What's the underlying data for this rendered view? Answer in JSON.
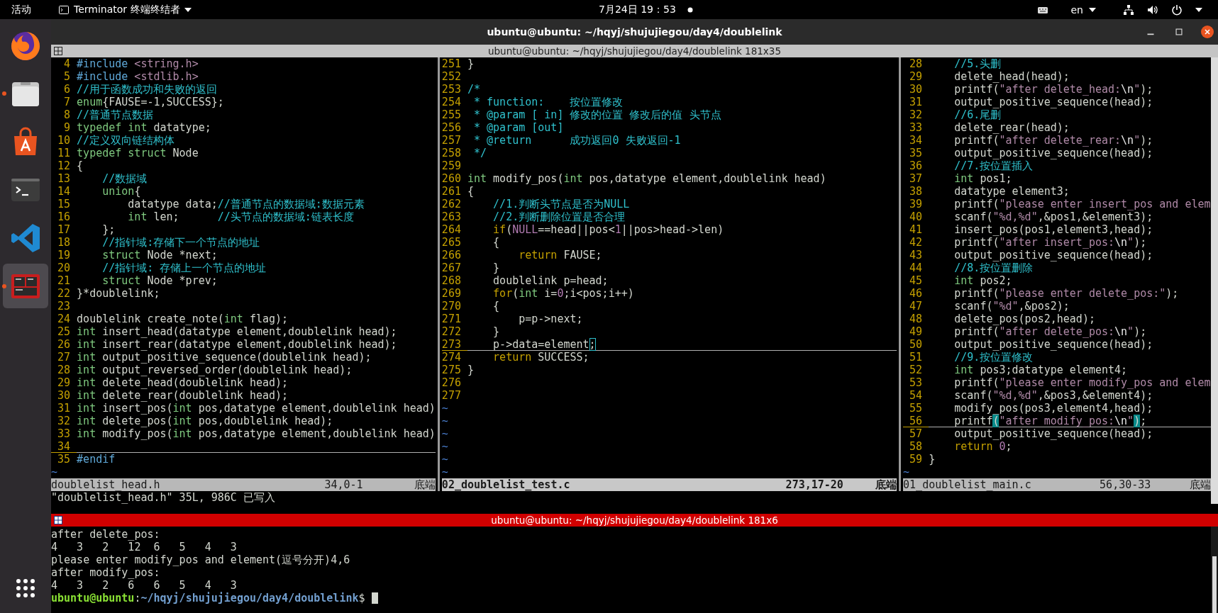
{
  "top_bar": {
    "activities": "活动",
    "app_menu": "Terminator 终端终结者",
    "clock": "7月24日  19：53",
    "language": "en"
  },
  "dock": {
    "apps": [
      {
        "running": false,
        "active": false
      },
      {
        "running": true,
        "active": false
      },
      {
        "running": false,
        "active": false
      },
      {
        "running": false,
        "active": false
      },
      {
        "running": false,
        "active": false
      },
      {
        "running": true,
        "active": true
      }
    ]
  },
  "window": {
    "title": "ubuntu@ubuntu: ~/hqyj/shujujiegou/day4/doublelink"
  },
  "upper_terminal": {
    "title": "ubuntu@ubuntu: ~/hqyj/shujujiegou/day4/doublelink 181x35",
    "panes": [
      {
        "lines": [
          {
            "number": "4",
            "current": false,
            "segments": [
              {
                "text": "#include",
                "kind": "preproc"
              },
              {
                "text": " <string.h>",
                "kind": "string"
              }
            ]
          },
          {
            "number": "5",
            "current": false,
            "segments": [
              {
                "text": "#include",
                "kind": "preproc"
              },
              {
                "text": " <stdlib.h>",
                "kind": "string"
              }
            ]
          },
          {
            "number": "6",
            "current": false,
            "segments": [
              {
                "text": "//用于函数成功和失败的返回",
                "kind": "comment"
              }
            ]
          },
          {
            "number": "7",
            "current": false,
            "segments": [
              {
                "text": "enum",
                "kind": "type"
              },
              {
                "text": "{FAUSE=-1,SUCCESS};",
                "kind": "plain"
              }
            ]
          },
          {
            "number": "8",
            "current": false,
            "segments": [
              {
                "text": "//普通节点数据",
                "kind": "comment"
              }
            ]
          },
          {
            "number": "9",
            "current": false,
            "segments": [
              {
                "text": "typedef int",
                "kind": "type"
              },
              {
                "text": " datatype;",
                "kind": "plain"
              }
            ]
          },
          {
            "number": "10",
            "current": false,
            "segments": [
              {
                "text": "//定义双向链结构体",
                "kind": "comment"
              }
            ]
          },
          {
            "number": "11",
            "current": false,
            "segments": [
              {
                "text": "typedef struct",
                "kind": "type"
              },
              {
                "text": " Node",
                "kind": "plain"
              }
            ]
          },
          {
            "number": "12",
            "current": false,
            "segments": [
              {
                "text": "{",
                "kind": "plain"
              }
            ]
          },
          {
            "number": "13",
            "current": false,
            "segments": [
              {
                "text": "    //数据域",
                "kind": "comment"
              }
            ]
          },
          {
            "number": "14",
            "current": false,
            "segments": [
              {
                "text": "    union",
                "kind": "type"
              },
              {
                "text": "{",
                "kind": "plain"
              }
            ]
          },
          {
            "number": "15",
            "current": false,
            "segments": [
              {
                "text": "        datatype data;",
                "kind": "plain"
              },
              {
                "text": "//普通节点的数据域:数据元素",
                "kind": "comment"
              }
            ]
          },
          {
            "number": "16",
            "current": false,
            "segments": [
              {
                "text": "        int",
                "kind": "type"
              },
              {
                "text": " len;      ",
                "kind": "plain"
              },
              {
                "text": "//头节点的数据域:链表长度",
                "kind": "comment"
              }
            ]
          },
          {
            "number": "17",
            "current": false,
            "segments": [
              {
                "text": "    };",
                "kind": "plain"
              }
            ]
          },
          {
            "number": "18",
            "current": false,
            "segments": [
              {
                "text": "    //指针域:存储下一个节点的地址",
                "kind": "comment"
              }
            ]
          },
          {
            "number": "19",
            "current": false,
            "segments": [
              {
                "text": "    struct",
                "kind": "type"
              },
              {
                "text": " Node *next;",
                "kind": "plain"
              }
            ]
          },
          {
            "number": "20",
            "current": false,
            "segments": [
              {
                "text": "    //指针域: 存储上一个节点的地址",
                "kind": "comment"
              }
            ]
          },
          {
            "number": "21",
            "current": false,
            "segments": [
              {
                "text": "    struct",
                "kind": "type"
              },
              {
                "text": " Node *prev;",
                "kind": "plain"
              }
            ]
          },
          {
            "number": "22",
            "current": false,
            "segments": [
              {
                "text": "}*doublelink;",
                "kind": "plain"
              }
            ]
          },
          {
            "number": "23",
            "current": false
          },
          {
            "number": "24",
            "current": false,
            "segments": [
              {
                "text": "doublelink create_note(",
                "kind": "plain"
              },
              {
                "text": "int",
                "kind": "type"
              },
              {
                "text": " flag);",
                "kind": "plain"
              }
            ]
          },
          {
            "number": "25",
            "current": false,
            "segments": [
              {
                "text": "int",
                "kind": "type"
              },
              {
                "text": " insert_head(datatype element,doublelink head);",
                "kind": "plain"
              }
            ]
          },
          {
            "number": "26",
            "current": false,
            "segments": [
              {
                "text": "int",
                "kind": "type"
              },
              {
                "text": " insert_rear(datatype element,doublelink head);",
                "kind": "plain"
              }
            ]
          },
          {
            "number": "27",
            "current": false,
            "segments": [
              {
                "text": "int",
                "kind": "type"
              },
              {
                "text": " output_positive_sequence(doublelink head);",
                "kind": "plain"
              }
            ]
          },
          {
            "number": "28",
            "current": false,
            "segments": [
              {
                "text": "int",
                "kind": "type"
              },
              {
                "text": " output_reversed_order(doublelink head);",
                "kind": "plain"
              }
            ]
          },
          {
            "number": "29",
            "current": false,
            "segments": [
              {
                "text": "int",
                "kind": "type"
              },
              {
                "text": " delete_head(doublelink head);",
                "kind": "plain"
              }
            ]
          },
          {
            "number": "30",
            "current": false,
            "segments": [
              {
                "text": "int",
                "kind": "type"
              },
              {
                "text": " delete_rear(doublelink head);",
                "kind": "plain"
              }
            ]
          },
          {
            "number": "31",
            "current": false,
            "segments": [
              {
                "text": "int",
                "kind": "type"
              },
              {
                "text": " insert_pos(",
                "kind": "plain"
              },
              {
                "text": "int",
                "kind": "type"
              },
              {
                "text": " pos,datatype element,doublelink head)",
                "kind": "plain"
              }
            ]
          },
          {
            "number": "32",
            "current": false,
            "segments": [
              {
                "text": "int",
                "kind": "type"
              },
              {
                "text": " delete_pos(",
                "kind": "plain"
              },
              {
                "text": "int",
                "kind": "type"
              },
              {
                "text": " pos,doublelink head);",
                "kind": "plain"
              }
            ]
          },
          {
            "number": "33",
            "current": false,
            "segments": [
              {
                "text": "int",
                "kind": "type"
              },
              {
                "text": " modify_pos(",
                "kind": "plain"
              },
              {
                "text": "int",
                "kind": "type"
              },
              {
                "text": " pos,datatype element,doublelink head)",
                "kind": "plain"
              }
            ]
          },
          {
            "number": "34",
            "current": true
          },
          {
            "number": "35",
            "current": false,
            "segments": [
              {
                "text": "#endif",
                "kind": "preproc"
              }
            ]
          }
        ],
        "filler": [
          "~"
        ],
        "status": {
          "file": "doublelist_head.h",
          "position": "34,0-1",
          "scroll": "底端",
          "active": false
        }
      },
      {
        "lines": [
          {
            "number": "251",
            "current": false,
            "segments": [
              {
                "text": "}",
                "kind": "plain"
              }
            ]
          },
          {
            "number": "252",
            "current": false
          },
          {
            "number": "253",
            "current": false,
            "segments": [
              {
                "text": "/*",
                "kind": "comment"
              }
            ]
          },
          {
            "number": "254",
            "current": false,
            "segments": [
              {
                "text": " * function:    按位置修改",
                "kind": "comment"
              }
            ]
          },
          {
            "number": "255",
            "current": false,
            "segments": [
              {
                "text": " * @param [ in] 修改的位置 修改后的值 头节点",
                "kind": "comment"
              }
            ]
          },
          {
            "number": "256",
            "current": false,
            "segments": [
              {
                "text": " * @param [out]",
                "kind": "comment"
              }
            ]
          },
          {
            "number": "257",
            "current": false,
            "segments": [
              {
                "text": " * @return      成功返回0 失败返回-1",
                "kind": "comment"
              }
            ]
          },
          {
            "number": "258",
            "current": false,
            "segments": [
              {
                "text": " */",
                "kind": "comment"
              }
            ]
          },
          {
            "number": "259",
            "current": false
          },
          {
            "number": "260",
            "current": false,
            "segments": [
              {
                "text": "int",
                "kind": "type"
              },
              {
                "text": " modify_pos(",
                "kind": "plain"
              },
              {
                "text": "int",
                "kind": "type"
              },
              {
                "text": " pos,datatype element,doublelink head)",
                "kind": "plain"
              }
            ]
          },
          {
            "number": "261",
            "current": false,
            "segments": [
              {
                "text": "{",
                "kind": "plain"
              }
            ]
          },
          {
            "number": "262",
            "current": false,
            "segments": [
              {
                "text": "    //1.判断头节点是否为NULL",
                "kind": "comment"
              }
            ]
          },
          {
            "number": "263",
            "current": false,
            "segments": [
              {
                "text": "    //2.判断删除位置是否合理",
                "kind": "comment"
              }
            ]
          },
          {
            "number": "264",
            "current": false,
            "segments": [
              {
                "text": "    if",
                "kind": "keyword"
              },
              {
                "text": "(",
                "kind": "plain"
              },
              {
                "text": "NULL",
                "kind": "constant"
              },
              {
                "text": "==head||pos<",
                "kind": "plain"
              },
              {
                "text": "1",
                "kind": "constant"
              },
              {
                "text": "||pos>head->len)",
                "kind": "plain"
              }
            ]
          },
          {
            "number": "265",
            "current": false,
            "segments": [
              {
                "text": "    {",
                "kind": "plain"
              }
            ]
          },
          {
            "number": "266",
            "current": false,
            "segments": [
              {
                "text": "        return",
                "kind": "keyword"
              },
              {
                "text": " FAUSE;",
                "kind": "plain"
              }
            ]
          },
          {
            "number": "267",
            "current": false,
            "segments": [
              {
                "text": "    }",
                "kind": "plain"
              }
            ]
          },
          {
            "number": "268",
            "current": false,
            "segments": [
              {
                "text": "    doublelink p=head;",
                "kind": "plain"
              }
            ]
          },
          {
            "number": "269",
            "current": false,
            "segments": [
              {
                "text": "    for",
                "kind": "keyword"
              },
              {
                "text": "(",
                "kind": "plain"
              },
              {
                "text": "int",
                "kind": "type"
              },
              {
                "text": " i=",
                "kind": "plain"
              },
              {
                "text": "0",
                "kind": "constant"
              },
              {
                "text": ";i<pos;i++)",
                "kind": "plain"
              }
            ]
          },
          {
            "number": "270",
            "current": false,
            "segments": [
              {
                "text": "    {",
                "kind": "plain"
              }
            ]
          },
          {
            "number": "271",
            "current": false,
            "segments": [
              {
                "text": "        p=p->next;",
                "kind": "plain"
              }
            ]
          },
          {
            "number": "272",
            "current": false,
            "segments": [
              {
                "text": "    }",
                "kind": "plain"
              }
            ]
          },
          {
            "number": "273",
            "current": true,
            "segments": [
              {
                "text": "    p->data=element",
                "kind": "plain"
              },
              {
                "text": ";",
                "kind": "cursor"
              }
            ]
          },
          {
            "number": "274",
            "current": false,
            "segments": [
              {
                "text": "    return",
                "kind": "keyword"
              },
              {
                "text": " SUCCESS;",
                "kind": "plain"
              }
            ]
          },
          {
            "number": "275",
            "current": false,
            "segments": [
              {
                "text": "}",
                "kind": "plain"
              }
            ]
          },
          {
            "number": "276",
            "current": false
          },
          {
            "number": "277",
            "current": false
          }
        ],
        "filler": [
          "~",
          "~",
          "~",
          "~",
          "~",
          "~"
        ],
        "status": {
          "file": "02_doublelist_test.c",
          "position": "273,17-20",
          "scroll": "底端",
          "active": true
        }
      },
      {
        "lines": [
          {
            "number": "28",
            "current": false,
            "segments": [
              {
                "text": "    //5.头删",
                "kind": "comment"
              }
            ]
          },
          {
            "number": "29",
            "current": false,
            "segments": [
              {
                "text": "    delete_head(head);",
                "kind": "plain"
              }
            ]
          },
          {
            "number": "30",
            "current": false,
            "segments": [
              {
                "text": "    printf(",
                "kind": "plain"
              },
              {
                "text": "\"after delete_head:",
                "kind": "string"
              },
              {
                "text": "\\n",
                "kind": "special"
              },
              {
                "text": "\"",
                "kind": "string"
              },
              {
                "text": ");",
                "kind": "plain"
              }
            ]
          },
          {
            "number": "31",
            "current": false,
            "segments": [
              {
                "text": "    output_positive_sequence(head);",
                "kind": "plain"
              }
            ]
          },
          {
            "number": "32",
            "current": false,
            "segments": [
              {
                "text": "    //6.尾删",
                "kind": "comment"
              }
            ]
          },
          {
            "number": "33",
            "current": false,
            "segments": [
              {
                "text": "    delete_rear(head);",
                "kind": "plain"
              }
            ]
          },
          {
            "number": "34",
            "current": false,
            "segments": [
              {
                "text": "    printf(",
                "kind": "plain"
              },
              {
                "text": "\"after delete_rear:",
                "kind": "string"
              },
              {
                "text": "\\n",
                "kind": "special"
              },
              {
                "text": "\"",
                "kind": "string"
              },
              {
                "text": ");",
                "kind": "plain"
              }
            ]
          },
          {
            "number": "35",
            "current": false,
            "segments": [
              {
                "text": "    output_positive_sequence(head);",
                "kind": "plain"
              }
            ]
          },
          {
            "number": "36",
            "current": false,
            "segments": [
              {
                "text": "    //7.按位置插入",
                "kind": "comment"
              }
            ]
          },
          {
            "number": "37",
            "current": false,
            "segments": [
              {
                "text": "    int",
                "kind": "type"
              },
              {
                "text": " pos1;",
                "kind": "plain"
              }
            ]
          },
          {
            "number": "38",
            "current": false,
            "segments": [
              {
                "text": "    datatype element3;",
                "kind": "plain"
              }
            ]
          },
          {
            "number": "39",
            "current": false,
            "segments": [
              {
                "text": "    printf(",
                "kind": "plain"
              },
              {
                "text": "\"please enter insert_pos and elem",
                "kind": "string"
              }
            ]
          },
          {
            "number": "40",
            "current": false,
            "segments": [
              {
                "text": "    scanf(",
                "kind": "plain"
              },
              {
                "text": "\"%d,%d\"",
                "kind": "string"
              },
              {
                "text": ",&pos1,&element3);",
                "kind": "plain"
              }
            ]
          },
          {
            "number": "41",
            "current": false,
            "segments": [
              {
                "text": "    insert_pos(pos1,element3,head);",
                "kind": "plain"
              }
            ]
          },
          {
            "number": "42",
            "current": false,
            "segments": [
              {
                "text": "    printf(",
                "kind": "plain"
              },
              {
                "text": "\"after insert_pos:",
                "kind": "string"
              },
              {
                "text": "\\n",
                "kind": "special"
              },
              {
                "text": "\"",
                "kind": "string"
              },
              {
                "text": ");",
                "kind": "plain"
              }
            ]
          },
          {
            "number": "43",
            "current": false,
            "segments": [
              {
                "text": "    output_positive_sequence(head);",
                "kind": "plain"
              }
            ]
          },
          {
            "number": "44",
            "current": false,
            "segments": [
              {
                "text": "    //8.按位置删除",
                "kind": "comment"
              }
            ]
          },
          {
            "number": "45",
            "current": false,
            "segments": [
              {
                "text": "    int",
                "kind": "type"
              },
              {
                "text": " pos2;",
                "kind": "plain"
              }
            ]
          },
          {
            "number": "46",
            "current": false,
            "segments": [
              {
                "text": "    printf(",
                "kind": "plain"
              },
              {
                "text": "\"please enter delete_pos:\"",
                "kind": "string"
              },
              {
                "text": ");",
                "kind": "plain"
              }
            ]
          },
          {
            "number": "47",
            "current": false,
            "segments": [
              {
                "text": "    scanf(",
                "kind": "plain"
              },
              {
                "text": "\"%d\"",
                "kind": "string"
              },
              {
                "text": ",&pos2);",
                "kind": "plain"
              }
            ]
          },
          {
            "number": "48",
            "current": false,
            "segments": [
              {
                "text": "    delete_pos(pos2,head);",
                "kind": "plain"
              }
            ]
          },
          {
            "number": "49",
            "current": false,
            "segments": [
              {
                "text": "    printf(",
                "kind": "plain"
              },
              {
                "text": "\"after delete_pos:",
                "kind": "string"
              },
              {
                "text": "\\n",
                "kind": "special"
              },
              {
                "text": "\"",
                "kind": "string"
              },
              {
                "text": ");",
                "kind": "plain"
              }
            ]
          },
          {
            "number": "50",
            "current": false,
            "segments": [
              {
                "text": "    output_positive_sequence(head);",
                "kind": "plain"
              }
            ]
          },
          {
            "number": "51",
            "current": false,
            "segments": [
              {
                "text": "    //9.按位置修改",
                "kind": "comment"
              }
            ]
          },
          {
            "number": "52",
            "current": false,
            "segments": [
              {
                "text": "    int",
                "kind": "type"
              },
              {
                "text": " pos3;datatype element4;",
                "kind": "plain"
              }
            ]
          },
          {
            "number": "53",
            "current": false,
            "segments": [
              {
                "text": "    printf(",
                "kind": "plain"
              },
              {
                "text": "\"please enter modify_pos and elem",
                "kind": "string"
              }
            ]
          },
          {
            "number": "54",
            "current": false,
            "segments": [
              {
                "text": "    scanf(",
                "kind": "plain"
              },
              {
                "text": "\"%d,%d\"",
                "kind": "string"
              },
              {
                "text": ",&pos3,&element4);",
                "kind": "plain"
              }
            ]
          },
          {
            "number": "55",
            "current": false,
            "segments": [
              {
                "text": "    modify_pos(pos3,element4,head);",
                "kind": "plain"
              }
            ]
          },
          {
            "number": "56",
            "current": true,
            "segments": [
              {
                "text": "    printf",
                "kind": "plain"
              },
              {
                "text": "(",
                "kind": "match"
              },
              {
                "text": "\"after modify_pos:",
                "kind": "string"
              },
              {
                "text": "\\n",
                "kind": "special"
              },
              {
                "text": "\"",
                "kind": "string"
              },
              {
                "text": ")",
                "kind": "match"
              },
              {
                "text": ";",
                "kind": "plain"
              }
            ]
          },
          {
            "number": "57",
            "current": false,
            "segments": [
              {
                "text": "    output_positive_sequence(head);",
                "kind": "plain"
              }
            ]
          },
          {
            "number": "58",
            "current": false,
            "segments": [
              {
                "text": "    return",
                "kind": "keyword"
              },
              {
                "text": " 0",
                "kind": "constant"
              },
              {
                "text": ";",
                "kind": "plain"
              }
            ]
          },
          {
            "number": "59",
            "current": false,
            "segments": [
              {
                "text": "}",
                "kind": "plain"
              }
            ]
          }
        ],
        "filler": [
          "~"
        ],
        "status": {
          "file": "01_doublelist_main.c",
          "position": "56,30-33",
          "scroll": "底端",
          "active": false
        }
      }
    ],
    "command_line": "\"doublelist_head.h\" 35L, 986C 已写入"
  },
  "lower_terminal": {
    "title": "ubuntu@ubuntu: ~/hqyj/shujujiegou/day4/doublelink 181x6",
    "output": [
      "after delete_pos:",
      "4   3   2   12  6   5   4   3",
      "please enter modify_pos and element(逗号分开)4,6",
      "after modify_pos:",
      "4   3   2   6   6   5   4   3"
    ],
    "prompt": {
      "user": "ubuntu@ubuntu",
      "separator": ":",
      "path": "~/hqyj/shujujiegou/day4/doublelink",
      "symbol": "$"
    }
  }
}
